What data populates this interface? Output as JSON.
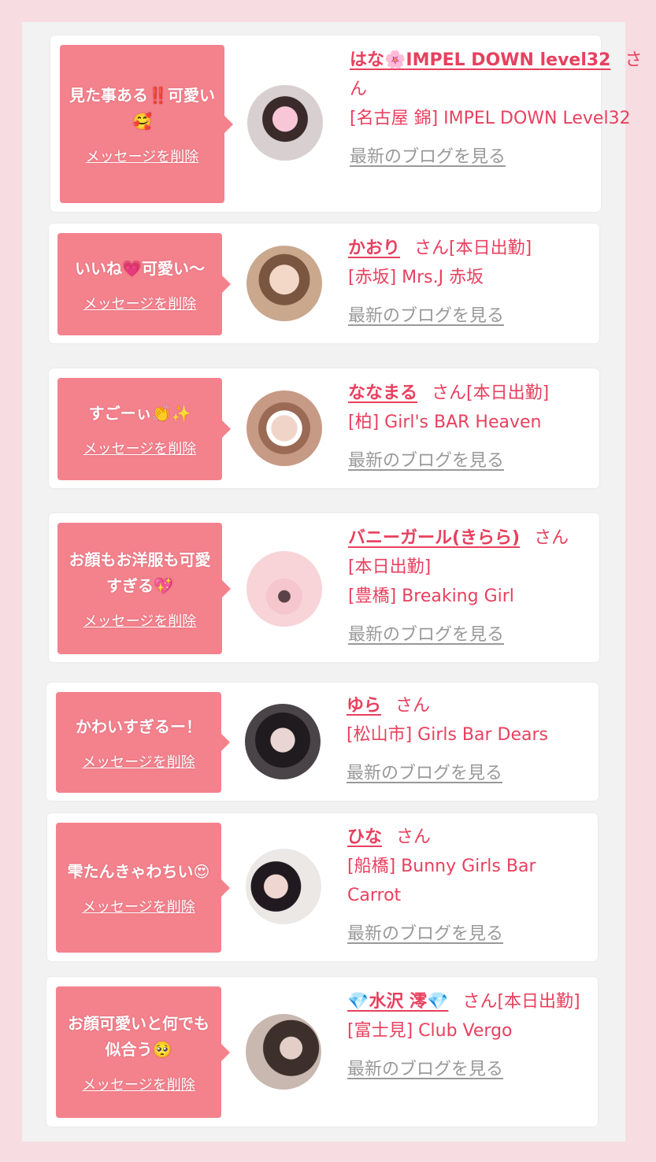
{
  "delete_label": "メッセージを削除",
  "san": "さん",
  "blog_label": "最新のブログを見る",
  "cards": [
    {
      "msg": "見た事ある‼️可愛い🥰",
      "name": "はな🌸IMPEL DOWN level32",
      "status": "",
      "store": "[名古屋 錦] IMPEL DOWN Level32"
    },
    {
      "msg": "いいね💗可愛い〜",
      "name": "かおり",
      "status": "[本日出勤]",
      "store": "[赤坂] Mrs.J 赤坂"
    },
    {
      "msg": "すごーぃ👏✨",
      "name": "ななまる",
      "status": "[本日出勤]",
      "store": "[柏] Girl's BAR Heaven"
    },
    {
      "msg": "お顔もお洋服も可愛すぎる💖",
      "name": "バニーガール(きらら)",
      "status": "[本日出勤]",
      "store": "[豊橋] Breaking Girl"
    },
    {
      "msg": "かわいすぎるー！",
      "name": "ゆら",
      "status": "",
      "store": "[松山市] Girls Bar Dears"
    },
    {
      "msg": "雫たんきゃわちい😍",
      "name": "ひな",
      "status": "",
      "store": "[船橋] Bunny Girls Bar Carrot"
    },
    {
      "msg": "お顔可愛いと何でも似合う🥺",
      "name": "💎水沢 澪💎",
      "status": "[本日出勤]",
      "store": "[富士見] Club Vergo"
    }
  ]
}
